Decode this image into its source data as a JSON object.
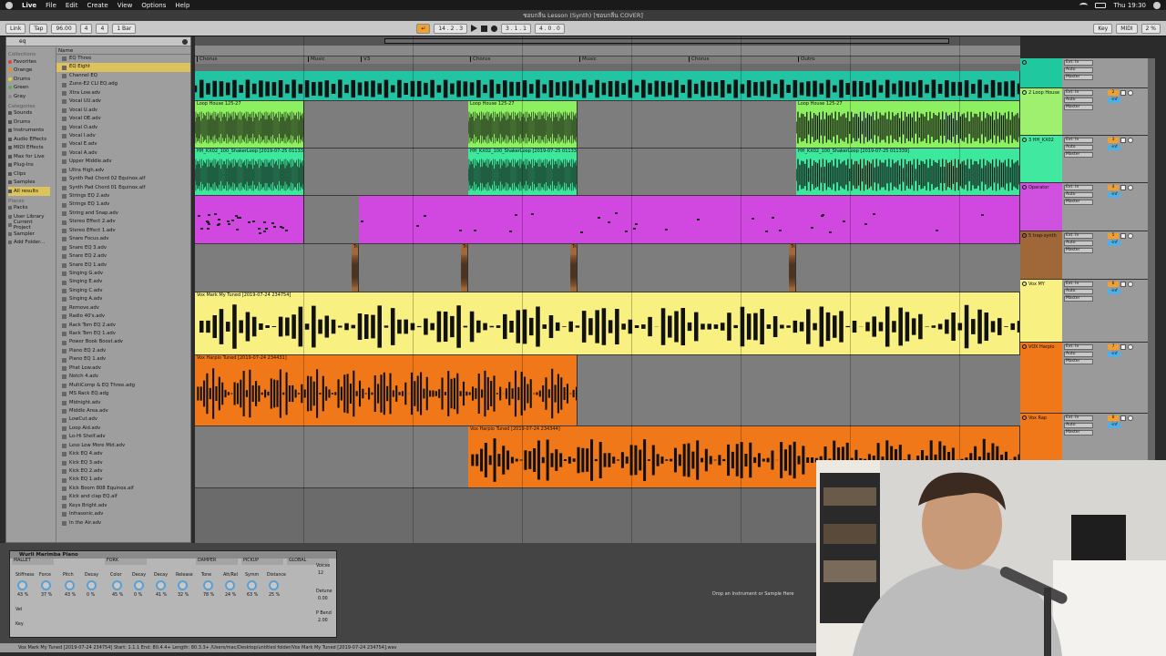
{
  "menubar": {
    "app": "Live",
    "items": [
      "File",
      "Edit",
      "Create",
      "View",
      "Options",
      "Help"
    ],
    "clock": "Thu 19:30"
  },
  "window_title": "ชอบกลีน Lesson (Synth) [ชอบกลีน COVER]",
  "transport": {
    "link": "Link",
    "tap": "Tap",
    "tempo": "96.00",
    "sig_num": "4",
    "sig_den": "4",
    "quant": "1 Bar",
    "position": "14 . 2 . 3",
    "loop_start": "3 . 1 . 1",
    "loop_len": "4 . 0 . 0",
    "key": "Key",
    "midi": "MIDI",
    "cpu": "2 %"
  },
  "browser": {
    "search": "eq",
    "collections_header": "Collections",
    "collections": [
      {
        "label": "Favorites",
        "color": "#e04040"
      },
      {
        "label": "Orange",
        "color": "#f08a20"
      },
      {
        "label": "Drums",
        "color": "#e0d030"
      },
      {
        "label": "Green",
        "color": "#50b040"
      },
      {
        "label": "Gray",
        "color": "#888888"
      }
    ],
    "categories_header": "Categories",
    "categories": [
      "Sounds",
      "Drums",
      "Instruments",
      "Audio Effects",
      "MIDI Effects",
      "Max for Live",
      "Plug-Ins",
      "Clips",
      "Samples",
      "All results"
    ],
    "places_header": "Places",
    "places": [
      "Packs",
      "User Library",
      "Current Project",
      "Sampler",
      "Add Folder..."
    ],
    "name_header": "Name",
    "files": [
      "EQ Three",
      "EQ Eight",
      "Channel EQ",
      "Zune-E2 CLI EQ.adg",
      "Xtra Low.adv",
      "Vocal UU.adv",
      "Vocal U.adv",
      "Vocal OE.adv",
      "Vocal O.adv",
      "Vocal I.adv",
      "Vocal E.adv",
      "Vocal A.adv",
      "Upper Middle.adv",
      "Ultra High.adv",
      "Synth Pad Chord 02 Equinox.alf",
      "Synth Pad Chord 01 Equinox.alf",
      "Strings EQ 2.adv",
      "Strings EQ 1.adv",
      "String and Snap.adv",
      "Stereo Effect 2.adv",
      "Stereo Effect 1.adv",
      "Snare Focus.adv",
      "Snare EQ 3.adv",
      "Snare EQ 2.adv",
      "Snare EQ 1.adv",
      "Singing G.adv",
      "Singing E.adv",
      "Singing C.adv",
      "Singing A.adv",
      "Remove.adv",
      "Radio 40's.adv",
      "Rack Tom EQ 2.adv",
      "Rack Tom EQ 1.adv",
      "Power Book Boost.adv",
      "Piano EQ 2.adv",
      "Piano EQ 1.adv",
      "Phat Low.adv",
      "Notch 4.adv",
      "MultiComp & EQ Three.adg",
      "MS Rack EQ.adg",
      "Midnight.adv",
      "Middle Area.adv",
      "LowCut.adv",
      "Loop Aid.adv",
      "Lo-Hi Shelf.adv",
      "Less Low More Mid.adv",
      "Kick EQ 4.adv",
      "Kick EQ 3.adv",
      "Kick EQ 2.adv",
      "Kick EQ 1.adv",
      "Kick Boom 808 Equinox.alf",
      "Kick and clap EQ.alf",
      "Keys Bright.adv",
      "Infrasonic.adv",
      "In the Air.adv"
    ]
  },
  "locators": [
    "Chorus",
    "Music",
    "V3",
    "Chorus",
    "Music",
    "Chorus",
    "Outro"
  ],
  "clips": {
    "loop_house": "Loop House 125-27",
    "hh": "HH_KX02_100_ShakerLoop [2019-07-25 011339]",
    "vox_mark": "Vox Mark My Tuned [2019-07-24 234754]",
    "vox_harpio": "Vox Harpio Tuned [2019-07-24 234431]",
    "vox_harpio2": "Vox Harpio Tuned [2019-07-24 234344]",
    "tra": "Tra"
  },
  "tracks": [
    {
      "name": "",
      "num": "",
      "color": "#20c8a0"
    },
    {
      "name": "2 Loop House",
      "num": "2",
      "color": "#a0f070"
    },
    {
      "name": "3 HH_KX02",
      "num": "3",
      "color": "#40e8a0"
    },
    {
      "name": "Operator",
      "num": "4",
      "color": "#d050e0"
    },
    {
      "name": "5 trap-synth",
      "num": "5",
      "color": "#a06838"
    },
    {
      "name": "Vox MY",
      "num": "6",
      "color": "#f8f080"
    },
    {
      "name": "VOX Harpio",
      "num": "7",
      "color": "#f07818"
    },
    {
      "name": "Vox Rap",
      "num": "8",
      "color": "#f07818"
    }
  ],
  "mixer": {
    "input": "Ext. In",
    "master": "Master",
    "auto": "Auto",
    "in": "In",
    "off": "Off",
    "ch": "1",
    "all_ins": "All Ins",
    "all_channels": "All Channels",
    "inf": "-inf"
  },
  "device": {
    "title": "Wurli Marimba Piano",
    "sections": [
      "MALLET",
      "FORK",
      "DAMPER",
      "PICKUP",
      "GLOBAL"
    ],
    "knobs": [
      {
        "label": "Stiffness",
        "value": "43 %"
      },
      {
        "label": "Force",
        "value": "37 %"
      },
      {
        "label": "Pitch",
        "value": "43 %"
      },
      {
        "label": "Decay",
        "value": "0 %"
      },
      {
        "label": "Color",
        "value": "45 %"
      },
      {
        "label": "Decay",
        "value": "0 %"
      },
      {
        "label": "Decay",
        "value": "41 %"
      },
      {
        "label": "Release",
        "value": "32 %"
      },
      {
        "label": "Tone",
        "value": "78 %"
      },
      {
        "label": "Att/Rel",
        "value": "24 %"
      },
      {
        "label": "Symm",
        "value": "63 %"
      },
      {
        "label": "Distance",
        "value": "25 %"
      }
    ],
    "sub_labels": [
      "Noise",
      "Time",
      "Tone",
      "Level",
      "Level",
      "Level",
      "Input",
      "Output",
      "Volume"
    ],
    "voices_label": "Voices",
    "voices": "12",
    "keybd": "Keybd",
    "detune": "Detune",
    "detune_val": "0.00",
    "pb_range": "P Bend",
    "pb_val": "2.00",
    "vel_label": "Vel",
    "key_label": "Key",
    "type_label": "Type"
  },
  "drop_hint": "Drop an Instrument or Sample Here",
  "status": "Vox Mark My Tuned [2019-07-24 234754]  Start: 1.1.1  End: 80.4.4+  Length: 80.3.3+  /Users/mac/Desktop/untitled folder/Vox Mark My Tuned [2019-07-24 234754].wav"
}
